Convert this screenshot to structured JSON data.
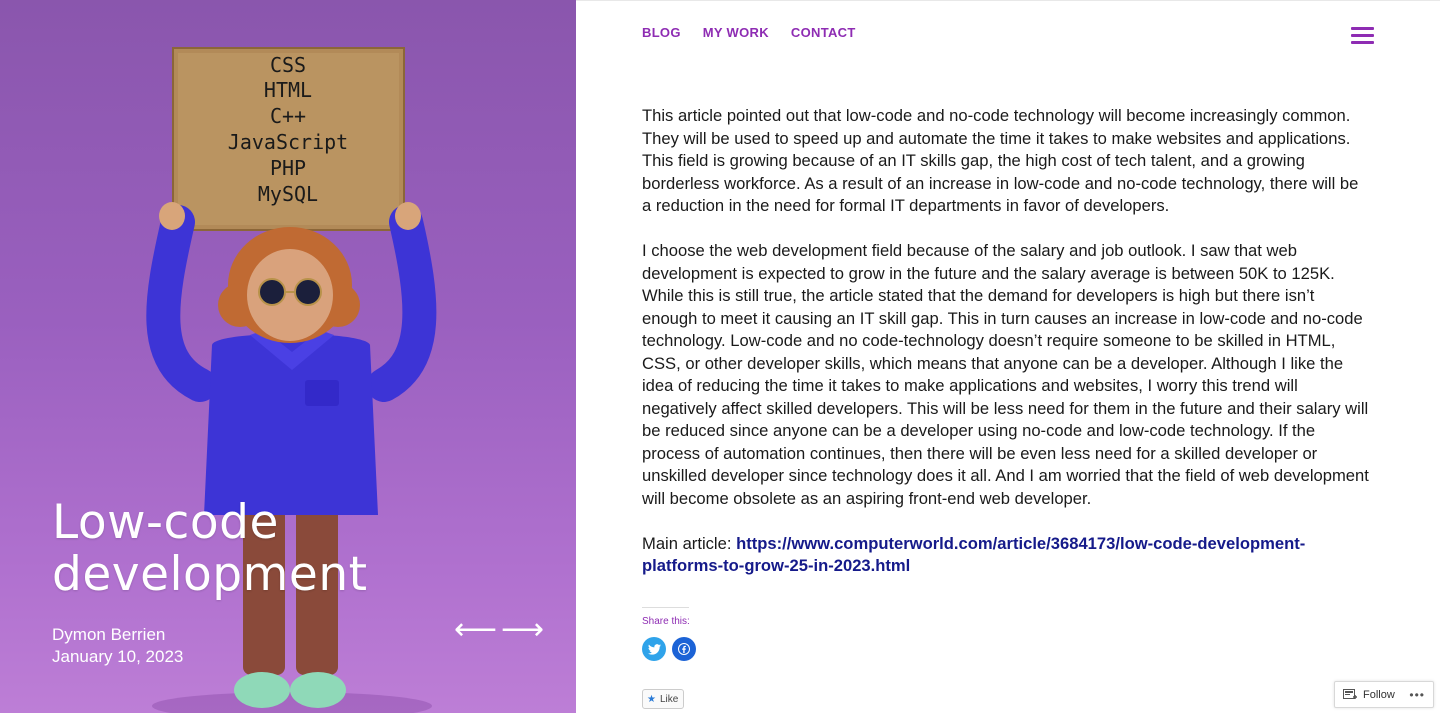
{
  "hero": {
    "sign_lines": [
      "CSS",
      "HTML",
      "C++",
      "JavaScript",
      "PHP",
      "MySQL"
    ],
    "title": "Low-code development",
    "author": "Dymon Berrien",
    "date": "January 10, 2023",
    "prev_arrow": "⟵",
    "next_arrow": "⟶"
  },
  "nav": {
    "items": [
      "BLOG",
      "MY WORK",
      "CONTACT"
    ],
    "menu_icon": "hamburger-icon"
  },
  "article": {
    "paragraph_1": "This article pointed out that low-code and no-code technology will become increasingly common. They will be used to speed up and automate the time it takes to make websites and applications. This field is growing because of an IT skills gap, the high cost of tech talent, and a growing borderless workforce. As a result of an increase in low-code and no-code technology, there will be a reduction in the need for formal IT departments in favor of developers.",
    "paragraph_2": "I choose the web development field because of the salary and job outlook. I saw that web development is expected to grow in the future and the salary average is between 50K to 125K. While this is still true, the article stated that the demand for developers is high but there isn’t enough to meet it causing an IT skill gap. This in turn causes an increase in low-code and no-code technology. Low-code and no code-technology doesn’t require someone to be skilled in HTML, CSS, or other developer skills, which means that anyone can be a developer. Although I like the idea of reducing the time it takes to make applications and websites, I worry this trend will negatively affect skilled developers. This will be less need for them in the future and their salary will be reduced since anyone can be a developer using no-code and low-code technology. If the process of automation continues, then there will be even less need for a skilled developer or unskilled developer since technology does it all. And I am worried that the field of web development will become obsolete as an aspiring front-end web developer.",
    "main_label": "Main article: ",
    "main_link": "https://www.computerworld.com/article/3684173/low-code-development-platforms-to-grow-25-in-2023.html"
  },
  "share": {
    "label": "Share this:",
    "icons": [
      "twitter-icon",
      "facebook-icon"
    ]
  },
  "like": {
    "label": "Like"
  },
  "follow": {
    "label": "Follow",
    "more": "•••"
  },
  "colors": {
    "accent": "#8e2cb3",
    "link": "#151a8a",
    "hero_bg": "#9a60bf",
    "shirt": "#3d34d6",
    "twitter": "#2fa3ea",
    "facebook": "#1c63d6"
  }
}
